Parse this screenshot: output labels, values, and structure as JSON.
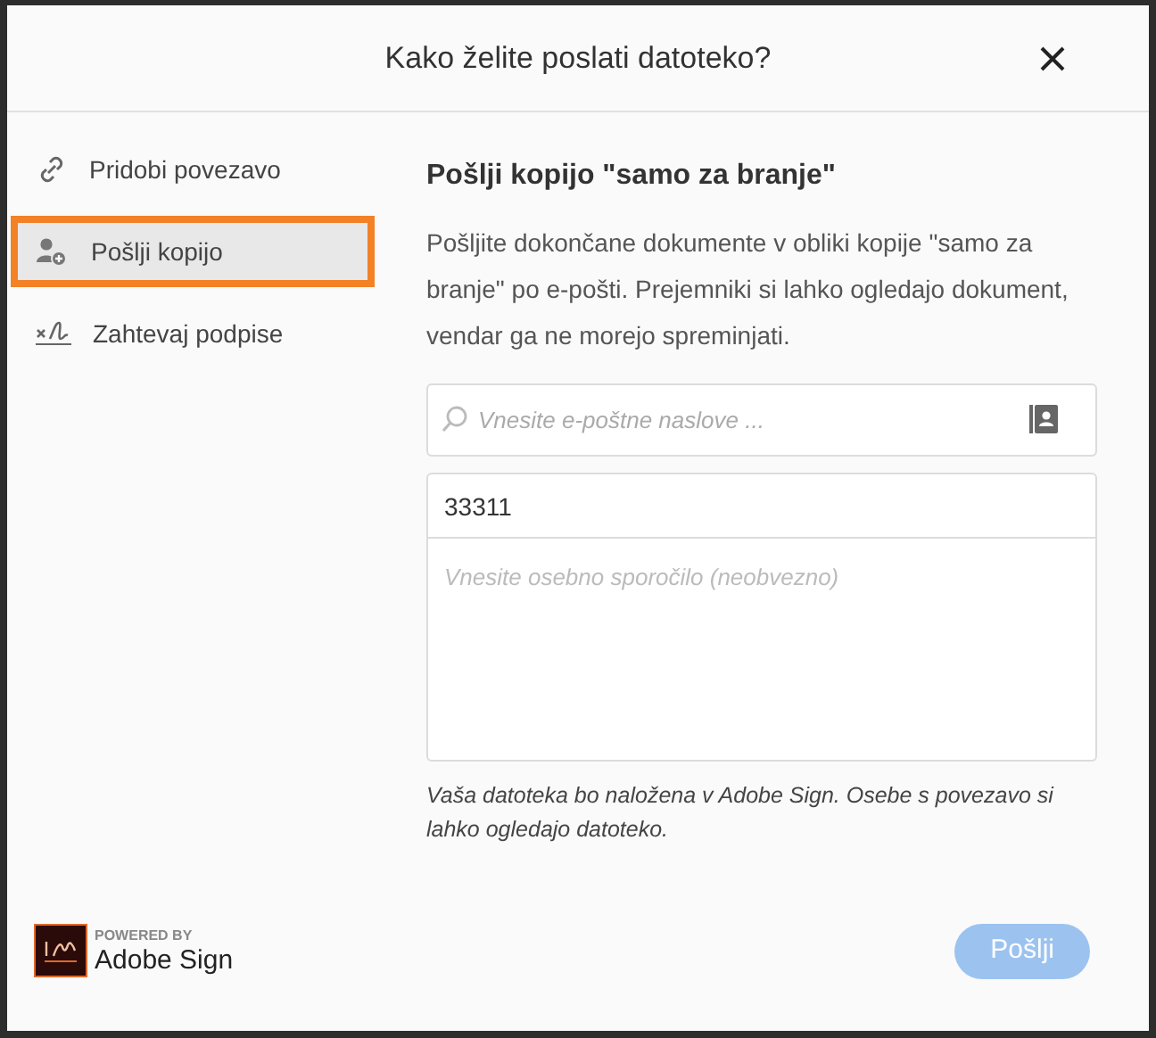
{
  "dialog": {
    "title": "Kako želite poslati datoteko?"
  },
  "sidebar": {
    "items": [
      {
        "label": "Pridobi povezavo",
        "kind": "link",
        "selected": false
      },
      {
        "label": "Pošlji kopijo",
        "kind": "copy",
        "selected": true
      },
      {
        "label": "Zahtevaj podpise",
        "kind": "sign",
        "selected": false
      }
    ]
  },
  "content": {
    "heading": "Pošlji kopijo \"samo za branje\"",
    "description": "Pošljite dokončane dokumente v obliki kopije \"samo za branje\" po e-pošti. Prejemniki si lahko ogledajo dokument, vendar ga ne morejo spreminjati.",
    "email_field": {
      "placeholder": "Vnesite e-poštne naslove ..."
    },
    "subject_field": {
      "value": "33311"
    },
    "message_field": {
      "placeholder": "Vnesite osebno sporočilo (neobvezno)"
    },
    "note": "Vaša datoteka bo naložena v Adobe Sign. Osebe s povezavo si lahko ogledajo datoteko."
  },
  "footer": {
    "powered_by": "POWERED BY",
    "brand": "Adobe Sign",
    "send_button": {
      "label": "Pošlji",
      "disabled": true
    }
  }
}
